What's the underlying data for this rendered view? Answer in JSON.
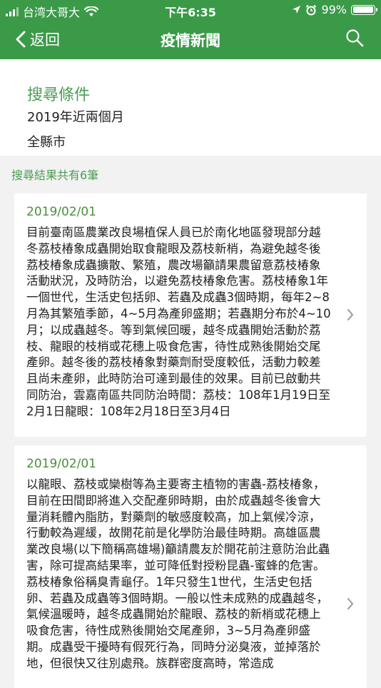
{
  "status_bar": {
    "carrier": "台湾大哥大",
    "time": "下午6:35",
    "battery": "99%",
    "battery_level": 0.99
  },
  "nav": {
    "back_label": "返回",
    "title": "疫情新聞",
    "search_icon": "search-icon"
  },
  "criteria": {
    "heading": "搜尋條件",
    "period": "2019年近兩個月",
    "region": "全縣市"
  },
  "results": {
    "count_text": "搜尋結果共有6筆",
    "items": [
      {
        "date": "2019/02/01",
        "text": "目前臺南區農業改良場植保人員已於南化地區發現部分越冬荔枝椿象成蟲開始取食龍眼及荔枝新梢，為避免越冬後荔枝椿象成蟲擴散、繁殖，農改場籲請果農留意荔枝椿象活動狀況，及時防治，以避免荔枝椿象危害。荔枝椿象1年一個世代，生活史包括卵、若蟲及成蟲3個時期，每年2~8月為其繁殖季節，4~5月為產卵盛期；若蟲期分布於4~10月；以成蟲越冬。等到氣候回暖，越冬成蟲開始活動於荔枝、龍眼的枝梢或花穗上吸食危害，待性成熟後開始交尾產卵。越冬後的荔枝椿象對藥劑耐受度較低，活動力較差且尚未產卵，此時防治可達到最佳的效果。目前已啟動共同防治，雲嘉南區共同防治時間：荔枝：108年1月19日至2月1日龍眼：108年2月18日至3月4日"
      },
      {
        "date": "2019/02/01",
        "text": "以龍眼、荔枝或欒樹等為主要寄主植物的害蟲-荔枝椿象，目前在田間即將進入交配產卵時期，由於成蟲越冬後會大量消耗體內脂肪，對藥劑的敏感度較高，加上氣候冷涼，行動較為遲緩，故開花前是化學防治最佳時期。高雄區農業改良場(以下簡稱高雄場)籲請農友於開花前注意防治此蟲害，除可提高結果率，並可降低對授粉昆蟲-蜜蜂的危害。荔枝椿象俗稱臭青龜仔。1年只發生1世代，生活史包括卵、若蟲及成蟲等3個時期。一般以性未成熟的成蟲越冬，氣候溫暖時，越冬成蟲開始於龍眼、荔枝的新梢或花穗上吸食危害，待性成熟後開始交尾產卵，3~5月為產卵盛期。成蟲受干擾時有假死行為，同時分泌臭液，並掉落於地，但很快又往別處飛。族群密度高時，常造成"
      }
    ]
  }
}
